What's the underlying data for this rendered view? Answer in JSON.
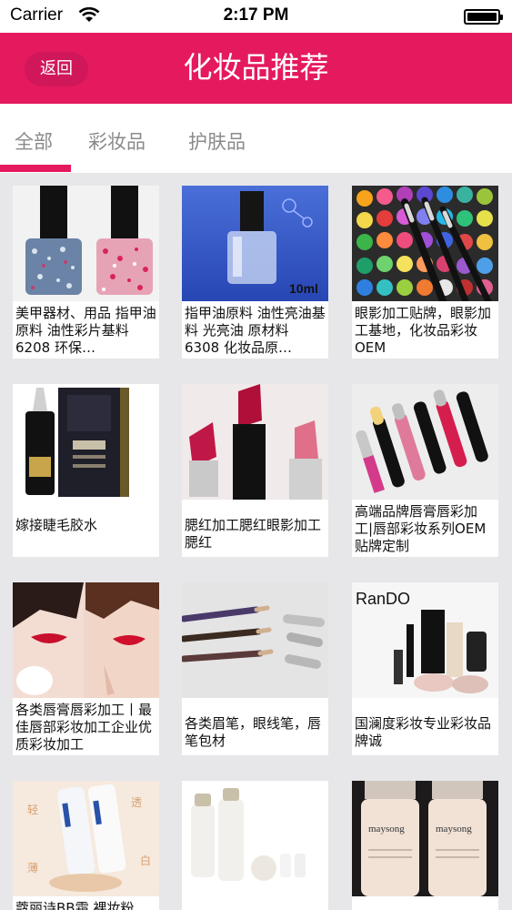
{
  "status_bar": {
    "carrier": "Carrier",
    "time": "2:17 PM"
  },
  "nav": {
    "back_label": "返回",
    "title": "化妆品推荐"
  },
  "tabs": [
    {
      "label": "全部",
      "selected": true
    },
    {
      "label": "彩妆品",
      "selected": false
    },
    {
      "label": "护肤品",
      "selected": false
    }
  ],
  "colors": {
    "accent": "#e5195e",
    "background": "#e7e7ea"
  },
  "products": [
    {
      "caption": "美甲器材、用品 指甲油原料 油性彩片基料 6208 环保…",
      "image": "glitter-nail-polish-bottles"
    },
    {
      "caption": "指甲油原料 油性亮油基料 光亮油 原材料 6308 化妆品原…",
      "image": "clear-nail-polish-bottle",
      "image_text": "10ml"
    },
    {
      "caption": "眼影加工贴牌，眼影加工基地，化妆品彩妆OEM",
      "image": "eyeshadow-palette-brushes"
    },
    {
      "caption": "嫁接睫毛胶水",
      "image": "eyelash-glue-bottle"
    },
    {
      "caption": "腮红加工腮红眼影加工腮红",
      "image": "lipsticks"
    },
    {
      "caption": "高端品牌唇膏唇彩加工|唇部彩妆系列OEM贴牌定制",
      "image": "lip-glosses"
    },
    {
      "caption": "各类唇膏唇彩加工丨最佳唇部彩妆加工企业优质彩妆加工",
      "image": "red-lips-models"
    },
    {
      "caption": "各类眉笔，眼线笔，唇笔包材",
      "image": "eyebrow-pencils"
    },
    {
      "caption": "国澜度彩妆专业彩妆品牌诚",
      "image": "rando-cosmetics-set",
      "image_text": "RanDO"
    },
    {
      "caption": "蔻丽诗BB霜 裸妆粉",
      "image": "bb-cream-tubes"
    },
    {
      "caption": "",
      "image": "white-skincare-bottles"
    },
    {
      "caption": "",
      "image": "maysong-toner-bottles",
      "image_text": "maysong"
    }
  ]
}
